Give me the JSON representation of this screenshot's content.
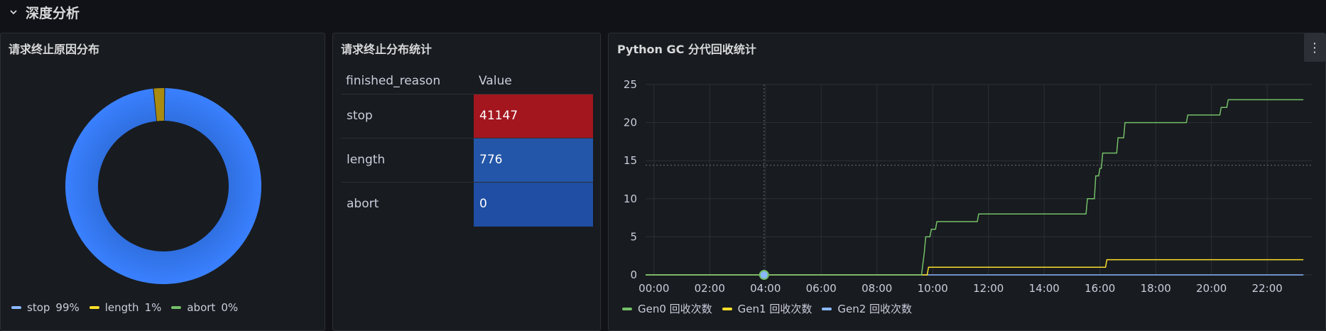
{
  "row": {
    "title": "深度分析",
    "chevron_icon": "chevron-down-icon"
  },
  "pie_panel": {
    "title": "请求终止原因分布",
    "slices": [
      {
        "label": "stop",
        "percent_label": "99%",
        "value": 41147,
        "color": "#3274d9"
      },
      {
        "label": "length",
        "percent_label": "1%",
        "value": 776,
        "color": "#a88b10"
      },
      {
        "label": "abort",
        "percent_label": "0%",
        "value": 0,
        "color": "#56a64b"
      }
    ],
    "legend_colors": {
      "stop": "#8ab8ff",
      "length": "#fade2a",
      "abort": "#73bf69"
    }
  },
  "table_panel": {
    "title": "请求终止分布统计",
    "columns": [
      "finished_reason",
      "Value"
    ],
    "rows": [
      {
        "name": "stop",
        "value": "41147",
        "color": "#a3161e"
      },
      {
        "name": "length",
        "value": "776",
        "color": "#2356a8"
      },
      {
        "name": "abort",
        "value": "0",
        "color": "#1f4ea4"
      }
    ]
  },
  "chart_panel": {
    "title": "Python GC 分代回收统计",
    "menu_icon": "more-vertical-icon",
    "chart_data": {
      "type": "line",
      "title": "Python GC 分代回收统计",
      "xlabel": "",
      "ylabel": "",
      "ylim": [
        0,
        25
      ],
      "xlim_hours": [
        -0.3,
        23.6
      ],
      "x_ticks": [
        "00:00",
        "02:00",
        "04:00",
        "06:00",
        "08:00",
        "10:00",
        "12:00",
        "14:00",
        "16:00",
        "18:00",
        "20:00",
        "22:00"
      ],
      "y_ticks": [
        "0",
        "5",
        "10",
        "15",
        "20",
        "25"
      ],
      "grid": true,
      "legend_position": "bottom-left",
      "series": [
        {
          "name": "Gen0 回收次数",
          "color": "#73bf69",
          "points": [
            [
              -0.3,
              0
            ],
            [
              9.6,
              0
            ],
            [
              9.7,
              3
            ],
            [
              9.75,
              5
            ],
            [
              9.9,
              5
            ],
            [
              9.95,
              6
            ],
            [
              10.1,
              6
            ],
            [
              10.15,
              7
            ],
            [
              11.6,
              7
            ],
            [
              11.65,
              8
            ],
            [
              15.5,
              8
            ],
            [
              15.55,
              10
            ],
            [
              15.8,
              10
            ],
            [
              15.85,
              13
            ],
            [
              15.95,
              13
            ],
            [
              16.0,
              14
            ],
            [
              16.05,
              14
            ],
            [
              16.1,
              16
            ],
            [
              16.6,
              16
            ],
            [
              16.65,
              18
            ],
            [
              16.85,
              18
            ],
            [
              16.9,
              20
            ],
            [
              19.1,
              20
            ],
            [
              19.15,
              21
            ],
            [
              20.3,
              21
            ],
            [
              20.35,
              22
            ],
            [
              20.55,
              22
            ],
            [
              20.6,
              23
            ],
            [
              23.3,
              23
            ]
          ]
        },
        {
          "name": "Gen1 回收次数",
          "color": "#fade2a",
          "points": [
            [
              -0.3,
              0
            ],
            [
              9.8,
              0
            ],
            [
              9.85,
              1
            ],
            [
              16.2,
              1
            ],
            [
              16.25,
              2
            ],
            [
              23.3,
              2
            ]
          ]
        },
        {
          "name": "Gen2 回收次数",
          "color": "#8ab8ff",
          "points": [
            [
              -0.3,
              0
            ],
            [
              23.3,
              0
            ]
          ]
        }
      ],
      "annotation_marker": {
        "hour": 3.95,
        "value": 0,
        "color": "#8ab8ff"
      },
      "crosshair_hour": 3.95,
      "crosshair_value": 14.4
    }
  }
}
